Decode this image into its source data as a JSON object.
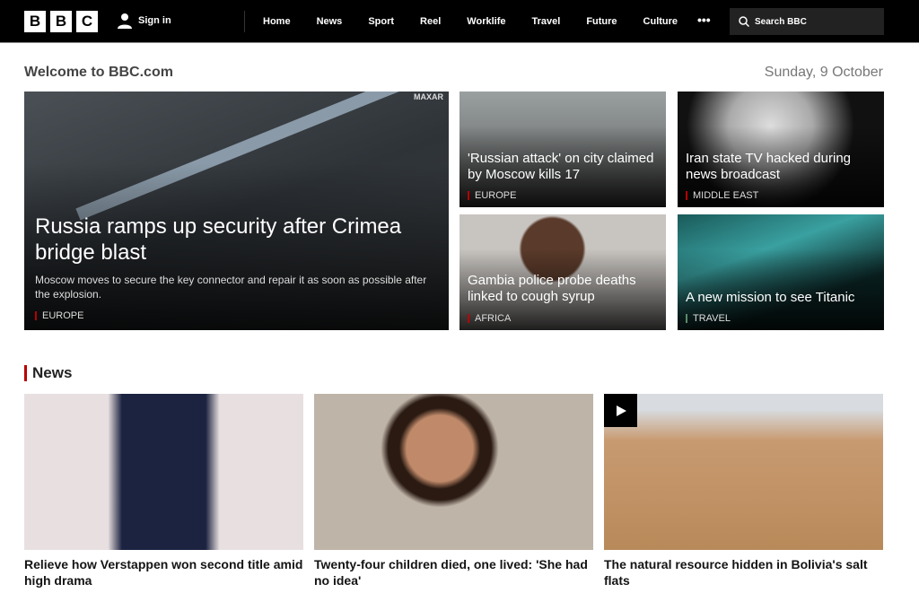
{
  "nav": {
    "logo": [
      "B",
      "B",
      "C"
    ],
    "sign_in": "Sign in",
    "links": [
      "Home",
      "News",
      "Sport",
      "Reel",
      "Worklife",
      "Travel",
      "Future",
      "Culture"
    ],
    "more": "•••",
    "search_placeholder": "Search BBC"
  },
  "header": {
    "welcome": "Welcome to BBC.com",
    "date": "Sunday, 9 October"
  },
  "hero": {
    "title": "Russia ramps up security after Crimea bridge blast",
    "summary": "Moscow moves to secure the key connector and repair it as soon as possible after the explosion.",
    "tag": "EUROPE",
    "watermark": "MAXAR"
  },
  "promos": [
    {
      "title": "'Russian attack' on city claimed by Moscow kills 17",
      "tag": "EUROPE"
    },
    {
      "title": "Iran state TV hacked during news broadcast",
      "tag": "MIDDLE EAST"
    },
    {
      "title": "Gambia police probe deaths linked to cough syrup",
      "tag": "AFRICA"
    },
    {
      "title": "A new mission to see Titanic",
      "tag": "TRAVEL",
      "tag_color": "#5a8a6a"
    }
  ],
  "news": {
    "heading": "News",
    "items": [
      {
        "title": "Relieve how Verstappen won second title amid high drama"
      },
      {
        "title": "Twenty-four children died, one lived: 'She had no idea'"
      },
      {
        "title": "The natural resource hidden in Bolivia's salt flats",
        "video": true
      }
    ]
  }
}
